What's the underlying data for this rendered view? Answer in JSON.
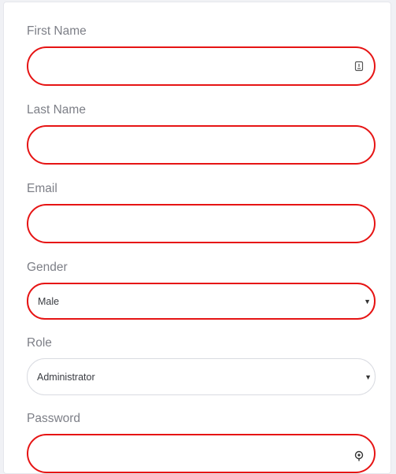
{
  "form": {
    "first_name": {
      "label": "First Name",
      "value": ""
    },
    "last_name": {
      "label": "Last Name",
      "value": ""
    },
    "email": {
      "label": "Email",
      "value": ""
    },
    "gender": {
      "label": "Gender",
      "selected": "Male"
    },
    "role": {
      "label": "Role",
      "selected": "Administrator"
    },
    "password": {
      "label": "Password",
      "value": ""
    }
  },
  "icons": {
    "first_name_field_icon": "contact-card-icon",
    "password_field_icon": "key-icon",
    "select_caret": "caret-down-icon"
  },
  "colors": {
    "error_border": "#e61414",
    "label_text": "#7d7f87",
    "neutral_border": "#d9dbe1"
  }
}
